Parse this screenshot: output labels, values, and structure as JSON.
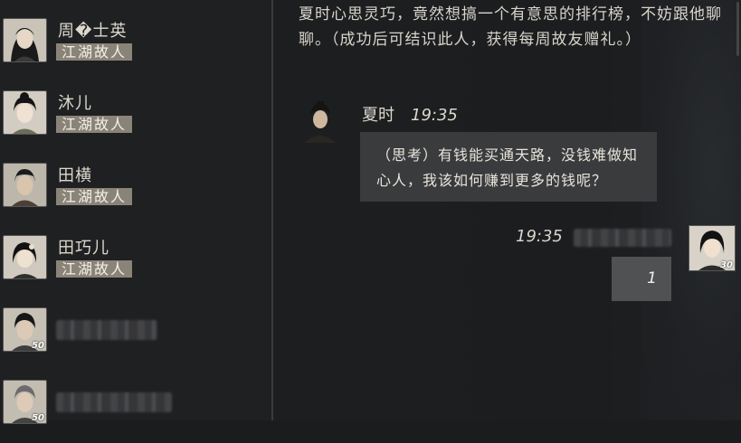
{
  "contacts": [
    {
      "name": "周�士英",
      "tag": "江湖故人"
    },
    {
      "name": "沐儿",
      "tag": "江湖故人"
    },
    {
      "name": "田横",
      "tag": "江湖故人"
    },
    {
      "name": "田巧儿",
      "tag": "江湖故人"
    },
    {
      "level": "50"
    },
    {
      "level": "50"
    }
  ],
  "chat": {
    "system_message": "夏时心思灵巧，竟然想搞一个有意思的排行榜，不妨跟他聊聊。（成功后可结识此人，获得每周故友赠礼。）",
    "npc": {
      "name": "夏时",
      "time": "19:35",
      "message": "（思考）有钱能买通天路，没钱难做知心人，我该如何赚到更多的钱呢？"
    },
    "player": {
      "time": "19:35",
      "level": "30",
      "message": "1"
    }
  }
}
